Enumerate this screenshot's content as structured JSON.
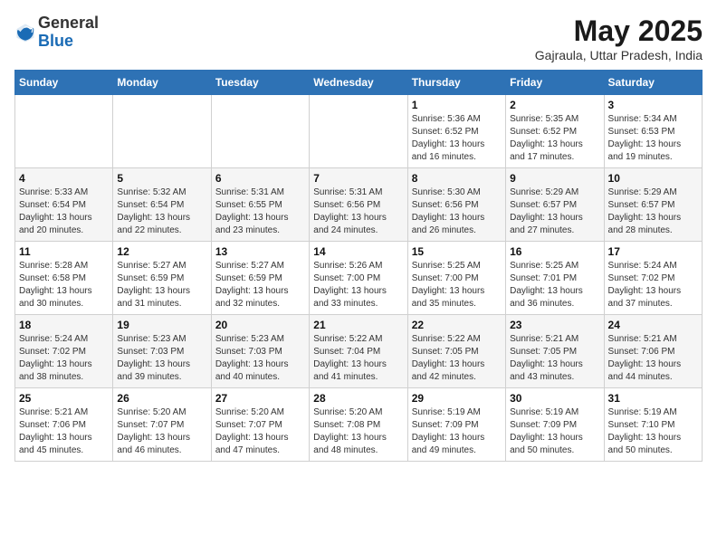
{
  "header": {
    "logo_line1": "General",
    "logo_line2": "Blue",
    "title": "May 2025",
    "subtitle": "Gajraula, Uttar Pradesh, India"
  },
  "weekdays": [
    "Sunday",
    "Monday",
    "Tuesday",
    "Wednesday",
    "Thursday",
    "Friday",
    "Saturday"
  ],
  "weeks": [
    [
      {
        "day": "",
        "detail": ""
      },
      {
        "day": "",
        "detail": ""
      },
      {
        "day": "",
        "detail": ""
      },
      {
        "day": "",
        "detail": ""
      },
      {
        "day": "1",
        "detail": "Sunrise: 5:36 AM\nSunset: 6:52 PM\nDaylight: 13 hours\nand 16 minutes."
      },
      {
        "day": "2",
        "detail": "Sunrise: 5:35 AM\nSunset: 6:52 PM\nDaylight: 13 hours\nand 17 minutes."
      },
      {
        "day": "3",
        "detail": "Sunrise: 5:34 AM\nSunset: 6:53 PM\nDaylight: 13 hours\nand 19 minutes."
      }
    ],
    [
      {
        "day": "4",
        "detail": "Sunrise: 5:33 AM\nSunset: 6:54 PM\nDaylight: 13 hours\nand 20 minutes."
      },
      {
        "day": "5",
        "detail": "Sunrise: 5:32 AM\nSunset: 6:54 PM\nDaylight: 13 hours\nand 22 minutes."
      },
      {
        "day": "6",
        "detail": "Sunrise: 5:31 AM\nSunset: 6:55 PM\nDaylight: 13 hours\nand 23 minutes."
      },
      {
        "day": "7",
        "detail": "Sunrise: 5:31 AM\nSunset: 6:56 PM\nDaylight: 13 hours\nand 24 minutes."
      },
      {
        "day": "8",
        "detail": "Sunrise: 5:30 AM\nSunset: 6:56 PM\nDaylight: 13 hours\nand 26 minutes."
      },
      {
        "day": "9",
        "detail": "Sunrise: 5:29 AM\nSunset: 6:57 PM\nDaylight: 13 hours\nand 27 minutes."
      },
      {
        "day": "10",
        "detail": "Sunrise: 5:29 AM\nSunset: 6:57 PM\nDaylight: 13 hours\nand 28 minutes."
      }
    ],
    [
      {
        "day": "11",
        "detail": "Sunrise: 5:28 AM\nSunset: 6:58 PM\nDaylight: 13 hours\nand 30 minutes."
      },
      {
        "day": "12",
        "detail": "Sunrise: 5:27 AM\nSunset: 6:59 PM\nDaylight: 13 hours\nand 31 minutes."
      },
      {
        "day": "13",
        "detail": "Sunrise: 5:27 AM\nSunset: 6:59 PM\nDaylight: 13 hours\nand 32 minutes."
      },
      {
        "day": "14",
        "detail": "Sunrise: 5:26 AM\nSunset: 7:00 PM\nDaylight: 13 hours\nand 33 minutes."
      },
      {
        "day": "15",
        "detail": "Sunrise: 5:25 AM\nSunset: 7:00 PM\nDaylight: 13 hours\nand 35 minutes."
      },
      {
        "day": "16",
        "detail": "Sunrise: 5:25 AM\nSunset: 7:01 PM\nDaylight: 13 hours\nand 36 minutes."
      },
      {
        "day": "17",
        "detail": "Sunrise: 5:24 AM\nSunset: 7:02 PM\nDaylight: 13 hours\nand 37 minutes."
      }
    ],
    [
      {
        "day": "18",
        "detail": "Sunrise: 5:24 AM\nSunset: 7:02 PM\nDaylight: 13 hours\nand 38 minutes."
      },
      {
        "day": "19",
        "detail": "Sunrise: 5:23 AM\nSunset: 7:03 PM\nDaylight: 13 hours\nand 39 minutes."
      },
      {
        "day": "20",
        "detail": "Sunrise: 5:23 AM\nSunset: 7:03 PM\nDaylight: 13 hours\nand 40 minutes."
      },
      {
        "day": "21",
        "detail": "Sunrise: 5:22 AM\nSunset: 7:04 PM\nDaylight: 13 hours\nand 41 minutes."
      },
      {
        "day": "22",
        "detail": "Sunrise: 5:22 AM\nSunset: 7:05 PM\nDaylight: 13 hours\nand 42 minutes."
      },
      {
        "day": "23",
        "detail": "Sunrise: 5:21 AM\nSunset: 7:05 PM\nDaylight: 13 hours\nand 43 minutes."
      },
      {
        "day": "24",
        "detail": "Sunrise: 5:21 AM\nSunset: 7:06 PM\nDaylight: 13 hours\nand 44 minutes."
      }
    ],
    [
      {
        "day": "25",
        "detail": "Sunrise: 5:21 AM\nSunset: 7:06 PM\nDaylight: 13 hours\nand 45 minutes."
      },
      {
        "day": "26",
        "detail": "Sunrise: 5:20 AM\nSunset: 7:07 PM\nDaylight: 13 hours\nand 46 minutes."
      },
      {
        "day": "27",
        "detail": "Sunrise: 5:20 AM\nSunset: 7:07 PM\nDaylight: 13 hours\nand 47 minutes."
      },
      {
        "day": "28",
        "detail": "Sunrise: 5:20 AM\nSunset: 7:08 PM\nDaylight: 13 hours\nand 48 minutes."
      },
      {
        "day": "29",
        "detail": "Sunrise: 5:19 AM\nSunset: 7:09 PM\nDaylight: 13 hours\nand 49 minutes."
      },
      {
        "day": "30",
        "detail": "Sunrise: 5:19 AM\nSunset: 7:09 PM\nDaylight: 13 hours\nand 50 minutes."
      },
      {
        "day": "31",
        "detail": "Sunrise: 5:19 AM\nSunset: 7:10 PM\nDaylight: 13 hours\nand 50 minutes."
      }
    ]
  ]
}
